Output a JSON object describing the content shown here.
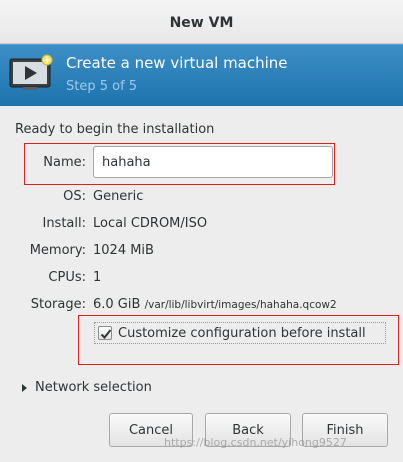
{
  "window": {
    "title": "New VM"
  },
  "banner": {
    "heading": "Create a new virtual machine",
    "step": "Step 5 of 5",
    "icon": "monitor-play-icon"
  },
  "section_title": "Ready to begin the installation",
  "fields": {
    "name": {
      "label": "Name:",
      "value": "hahaha"
    },
    "os": {
      "label": "OS:",
      "value": "Generic"
    },
    "install": {
      "label": "Install:",
      "value": "Local CDROM/ISO"
    },
    "memory": {
      "label": "Memory:",
      "value": "1024 MiB"
    },
    "cpus": {
      "label": "CPUs:",
      "value": "1"
    },
    "storage": {
      "label": "Storage:",
      "size": "6.0 GiB",
      "path": "/var/lib/libvirt/images/hahaha.qcow2"
    }
  },
  "customize": {
    "label": "Customize configuration before install",
    "checked": true
  },
  "network": {
    "label": "Network selection",
    "expanded": false
  },
  "buttons": {
    "cancel": "Cancel",
    "back": "Back",
    "finish": "Finish"
  },
  "watermark": "https://blog.csdn.net/yihong9527",
  "colors": {
    "banner": "#2a7eb7",
    "highlight_box": "#e02020"
  }
}
